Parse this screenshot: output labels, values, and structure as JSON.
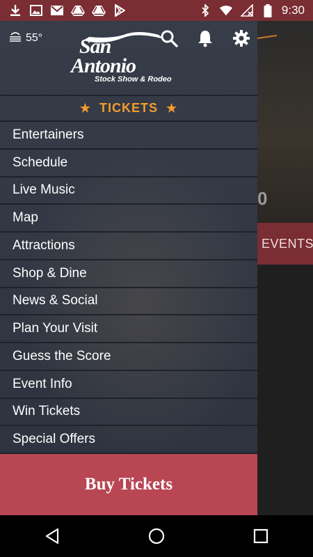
{
  "status_bar": {
    "time": "9:30",
    "left_icons": [
      "download-icon",
      "image-icon",
      "gmail-icon",
      "drive-icon",
      "drive-icon",
      "play-store-icon"
    ],
    "right_icons": [
      "bluetooth-icon",
      "wifi-icon",
      "no-sim-icon",
      "battery-icon"
    ]
  },
  "header": {
    "temperature": "55°",
    "weather_icon": "fog-icon",
    "logo": {
      "line1": "San",
      "line2": "Antonio",
      "line3": "Stock Show & Rodeo"
    },
    "icons": [
      "search-icon",
      "bell-icon",
      "gear-icon"
    ]
  },
  "tickets_label": "TICKETS",
  "menu": {
    "items": [
      {
        "label": "Entertainers"
      },
      {
        "label": "Schedule"
      },
      {
        "label": "Live Music"
      },
      {
        "label": "Map"
      },
      {
        "label": "Attractions"
      },
      {
        "label": "Shop & Dine"
      },
      {
        "label": "News & Social"
      },
      {
        "label": "Plan Your Visit"
      },
      {
        "label": "Guess the Score"
      },
      {
        "label": "Event Info"
      },
      {
        "label": "Win Tickets"
      },
      {
        "label": "Special Offers"
      }
    ]
  },
  "buy_button": "Buy Tickets",
  "background": {
    "events_label": "EVENTS",
    "number": "0"
  },
  "colors": {
    "accent": "#f49b2c",
    "brand": "#b84653",
    "status": "#7a2d33",
    "drawer": "#363c48"
  }
}
